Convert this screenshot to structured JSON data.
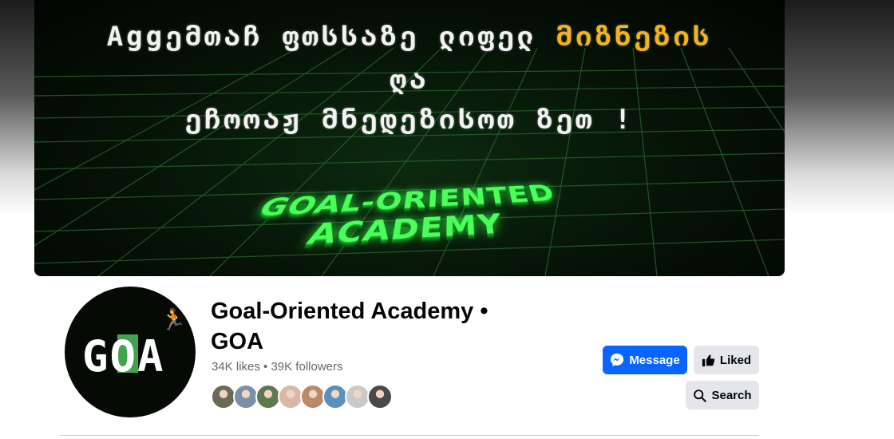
{
  "cover": {
    "line1_white": "Aggემთაჩ ფთსსაზე ლიფელ",
    "line1_yellow": "მიზნეზის",
    "line2": "ღა",
    "line3": "ეჩოოაჟ მნედეზისოთ ზეთ !",
    "logo_text": "GOAL-ORIENTED ACADEMY"
  },
  "avatar": {
    "text": "GOA"
  },
  "page": {
    "title": "Goal-Oriented Academy • GOA",
    "stats": "34K likes • 39K followers"
  },
  "friends": {
    "colors": [
      "#6b6b55",
      "#7a8fa8",
      "#5d7a4d",
      "#d9b8a6",
      "#b88a6a",
      "#5b8fbf",
      "#c9c9c9",
      "#4a4a4a"
    ]
  },
  "actions": {
    "message_label": "Message",
    "liked_label": "Liked",
    "search_label": "Search"
  },
  "colors": {
    "primary": "#0866ff",
    "secondary_button": "#e4e6eb",
    "cover_accent": "#4aff5a",
    "cover_yellow": "#f3b41b"
  }
}
